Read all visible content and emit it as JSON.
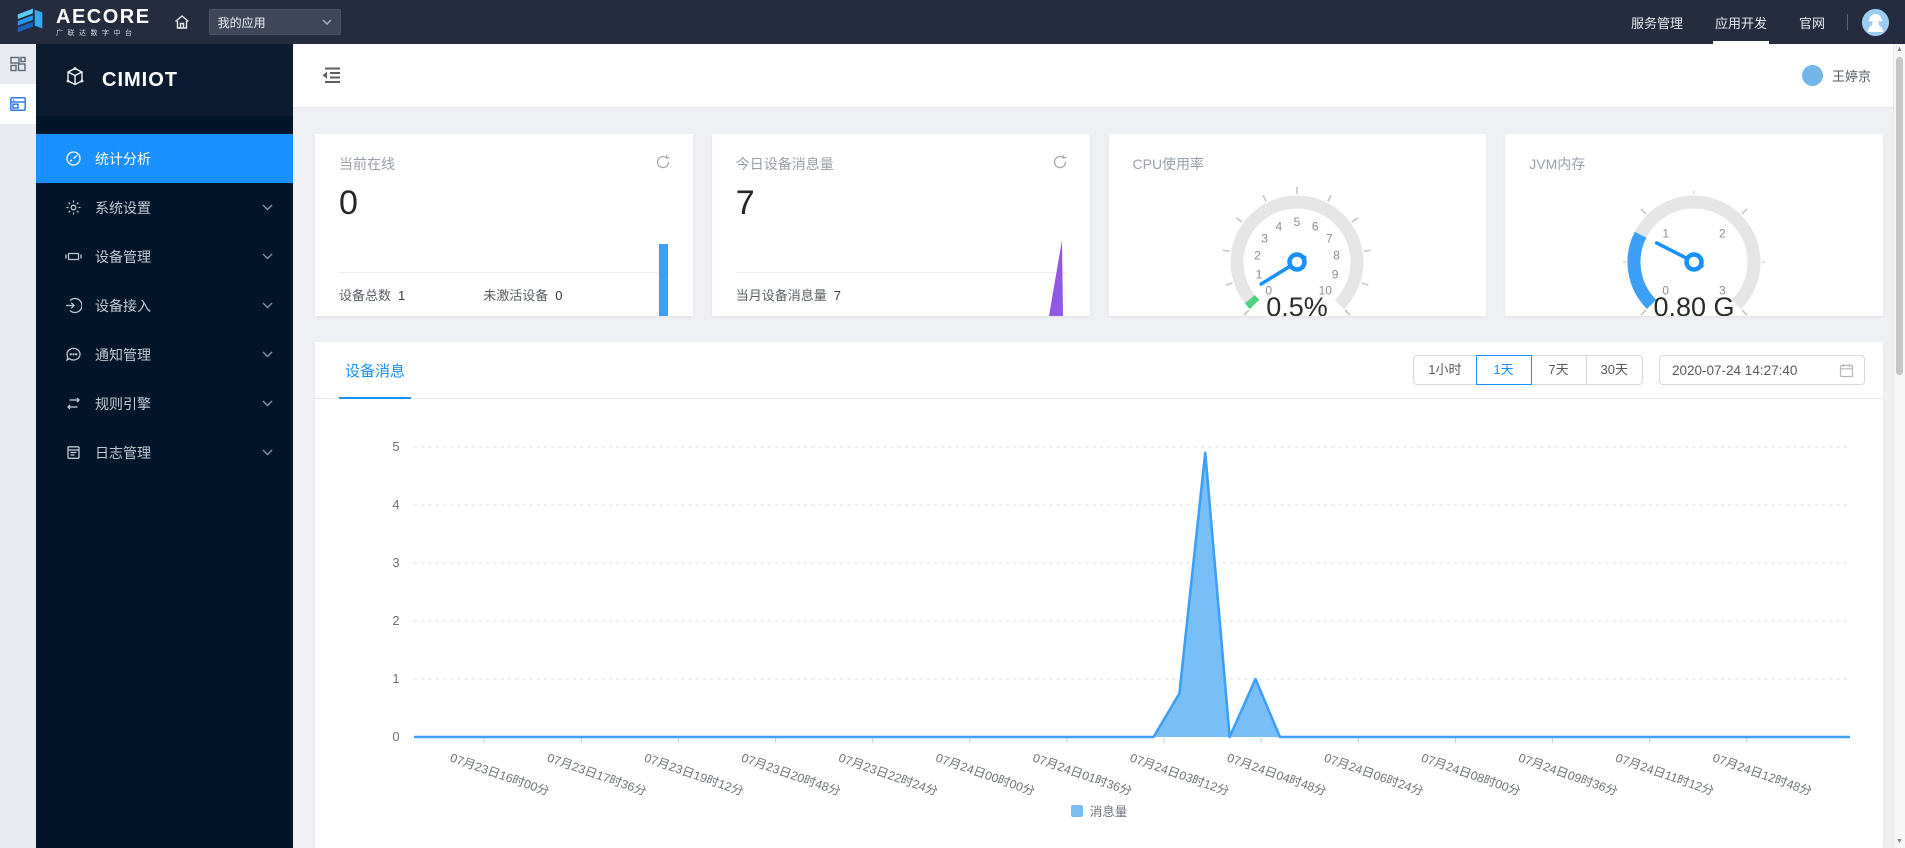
{
  "colors": {
    "accent": "#1890ff",
    "chart_line": "#3ca0f6",
    "chart_fill": "#79bff7",
    "legend_swatch": "#7cbdf2",
    "card1_spark": "#3d9ef6",
    "card2_spark": "#9157e6",
    "gauge_green": "#4fd27d",
    "gauge_blue": "#3ca0f6",
    "topbar_bg": "#262c3f",
    "sidebar_bg": "#03152a"
  },
  "topbar": {
    "brand": "AECORE",
    "brand_sub": "广联达数字中台",
    "app_select": {
      "value": "我的应用"
    },
    "links": [
      {
        "label": "服务管理",
        "active": false
      },
      {
        "label": "应用开发",
        "active": true
      },
      {
        "label": "官网",
        "active": false
      }
    ]
  },
  "rail": {
    "items": [
      {
        "name": "apps-overview",
        "icon": "apps-grid-icon",
        "active": false
      },
      {
        "name": "current-app",
        "icon": "app-window-icon",
        "active": true
      }
    ]
  },
  "sidebar": {
    "logo_text": "CIMIOT",
    "items": [
      {
        "name": "statistics",
        "label": "统计分析",
        "icon": "gauge-icon",
        "active": true,
        "has_children": false
      },
      {
        "name": "system-settings",
        "label": "系统设置",
        "icon": "gear-icon",
        "active": false,
        "has_children": true
      },
      {
        "name": "device-management",
        "label": "设备管理",
        "icon": "device-icon",
        "active": false,
        "has_children": true
      },
      {
        "name": "device-access",
        "label": "设备接入",
        "icon": "access-icon",
        "active": false,
        "has_children": true
      },
      {
        "name": "notification-management",
        "label": "通知管理",
        "icon": "message-icon",
        "active": false,
        "has_children": true
      },
      {
        "name": "rule-engine",
        "label": "规则引擎",
        "icon": "rules-icon",
        "active": false,
        "has_children": true
      },
      {
        "name": "log-management",
        "label": "日志管理",
        "icon": "log-icon",
        "active": false,
        "has_children": true
      }
    ]
  },
  "main_header": {
    "user_name": "王婷京"
  },
  "cards": [
    {
      "title": "当前在线",
      "value": "0",
      "has_refresh": true,
      "footer": [
        {
          "label": "设备总数",
          "value": "1"
        },
        {
          "label": "未激活设备",
          "value": "0"
        }
      ]
    },
    {
      "title": "今日设备消息量",
      "value": "7",
      "has_refresh": true,
      "footer": [
        {
          "label": "当月设备消息量",
          "value": "7"
        }
      ]
    },
    {
      "title": "CPU使用率"
    },
    {
      "title": "JVM内存"
    }
  ],
  "chart_panel": {
    "tab_label": "设备消息",
    "ranges": [
      "1小时",
      "1天",
      "7天",
      "30天"
    ],
    "active_range": "1天",
    "datetime_value": "2020-07-24 14:27:40",
    "legend_label": "消息量"
  },
  "chart_data": [
    {
      "type": "gauge",
      "title": "CPU使用率",
      "min": 0,
      "max": 10,
      "value": 0.5,
      "unit": "%",
      "value_label": "0.5%",
      "tick_labels": [
        0,
        1,
        2,
        3,
        4,
        5,
        6,
        7,
        8,
        9,
        10
      ],
      "minor_step": 1,
      "start_angle": 225,
      "sweep": 270,
      "progress_to": 0.25,
      "progress_color": "#4fd27d",
      "needle_color": "#1890ff"
    },
    {
      "type": "gauge",
      "title": "JVM内存",
      "min": 0,
      "max": 3,
      "value": 0.8,
      "unit": "G",
      "value_label": "0.80 G",
      "tick_labels": [
        0,
        1,
        2,
        3
      ],
      "minor_step": 0.5,
      "start_angle": 225,
      "sweep": 270,
      "progress_to": 0.8,
      "progress_color": "#3ca0f6",
      "needle_color": "#1890ff"
    },
    {
      "type": "area",
      "title": "设备消息",
      "series": [
        {
          "name": "消息量",
          "color": "#3ca0f6",
          "fill": "#79bff7",
          "points": [
            [
              0,
              0
            ],
            [
              0.515,
              0
            ],
            [
              0.533,
              0.75
            ],
            [
              0.551,
              4.9
            ],
            [
              0.568,
              0
            ],
            [
              0.586,
              1
            ],
            [
              0.603,
              0
            ],
            [
              1,
              0
            ]
          ]
        }
      ],
      "peaks_note": "spike of 5 near 07月24日03时, secondary peak 1 near 07月24日04时, total today = 7",
      "x_tick_labels": [
        "07月23日16时00分",
        "07月23日17时36分",
        "07月23日19时12分",
        "07月23日20时48分",
        "07月23日22时24分",
        "07月24日00时00分",
        "07月24日01时36分",
        "07月24日03时12分",
        "07月24日04时48分",
        "07月24日06时24分",
        "07月24日08时00分",
        "07月24日09时36分",
        "07月24日11时12分",
        "07月24日12时48分"
      ],
      "ylim": [
        0,
        5
      ],
      "y_ticks": [
        0,
        1,
        2,
        3,
        4,
        5
      ],
      "grid": "horizontal-dashed",
      "legend": [
        "消息量"
      ],
      "legend_position": "bottom"
    }
  ]
}
